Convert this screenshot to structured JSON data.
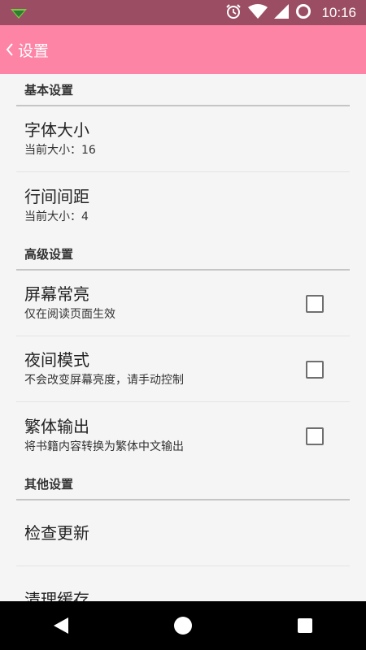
{
  "status_bar": {
    "time": "10:16",
    "icons": [
      "notification-icon",
      "alarm-icon",
      "wifi-icon",
      "signal-icon",
      "battery-icon"
    ]
  },
  "toolbar": {
    "title": "设置",
    "back_icon": "chevron-left-icon"
  },
  "sections": {
    "basic": {
      "header": "基本设置",
      "font_size": {
        "title": "字体大小",
        "summary": "当前大小：16"
      },
      "line_spacing": {
        "title": "行间间距",
        "summary": "当前大小：4"
      }
    },
    "advanced": {
      "header": "高级设置",
      "screen_on": {
        "title": "屏幕常亮",
        "summary": "仅在阅读页面生效",
        "checked": false
      },
      "night_mode": {
        "title": "夜间模式",
        "summary": "不会改变屏幕亮度，请手动控制",
        "checked": false
      },
      "traditional": {
        "title": "繁体输出",
        "summary": "将书籍内容转换为繁体中文输出",
        "checked": false
      }
    },
    "other": {
      "header": "其他设置",
      "check_update": {
        "title": "检查更新"
      },
      "clear_cache": {
        "title": "清理缓存"
      }
    }
  },
  "colors": {
    "toolbar": "#fe84a6",
    "status_bar": "#9b4e63",
    "background": "#f5f5f5",
    "nav_bar": "#000000"
  },
  "nav_bar": {
    "icons": [
      "back-triangle-icon",
      "home-circle-icon",
      "recents-square-icon"
    ]
  }
}
